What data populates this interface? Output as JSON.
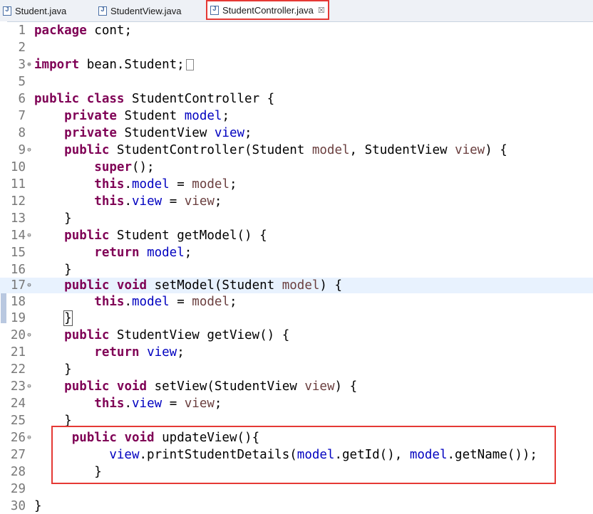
{
  "tabs": [
    {
      "label": "Student.java",
      "active": false
    },
    {
      "label": "StudentView.java",
      "active": false
    },
    {
      "label": "StudentController.java",
      "active": true,
      "close": "☒"
    }
  ],
  "colors": {
    "keyword": "#7f0055",
    "field": "#0000c0",
    "param": "#6a3e3e",
    "highlight": "#e53935"
  },
  "code": {
    "line1": [
      "package",
      " cont;"
    ],
    "line3": [
      "import",
      " bean.Student;"
    ],
    "line6": [
      "public",
      "class",
      " StudentController {"
    ],
    "line7": [
      "private",
      " Student ",
      "model",
      ";"
    ],
    "line8": [
      "private",
      " StudentView ",
      "view",
      ";"
    ],
    "line9": [
      "public",
      " StudentController(Student ",
      "model",
      ", StudentView ",
      "view",
      ") {"
    ],
    "line10": [
      "super",
      "();"
    ],
    "line11": [
      "this",
      ".",
      "model",
      " = ",
      "model",
      ";"
    ],
    "line12": [
      "this",
      ".",
      "view",
      " = ",
      "view",
      ";"
    ],
    "line13": [
      "}"
    ],
    "line14": [
      "public",
      " Student getModel() {"
    ],
    "line15": [
      "return",
      "model",
      ";"
    ],
    "line16": [
      "}"
    ],
    "line17": [
      "public",
      "void",
      " setModel(Student ",
      "model",
      ") {"
    ],
    "line18": [
      "this",
      ".",
      "model",
      " = ",
      "model",
      ";"
    ],
    "line19": [
      "}"
    ],
    "line20": [
      "public",
      " StudentView getView() {"
    ],
    "line21": [
      "return",
      "view",
      ";"
    ],
    "line22": [
      "}"
    ],
    "line23": [
      "public",
      "void",
      " setView(StudentView ",
      "view",
      ") {"
    ],
    "line24": [
      "this",
      ".",
      "view",
      " = ",
      "view",
      ";"
    ],
    "line25": [
      "}"
    ],
    "line26": [
      "public",
      "void",
      " updateView(){"
    ],
    "line27": [
      "view",
      ".printStudentDetails(",
      "model",
      ".getId(), ",
      "model",
      ".getName());"
    ],
    "line28": [
      "}"
    ],
    "line30": [
      "}"
    ]
  }
}
